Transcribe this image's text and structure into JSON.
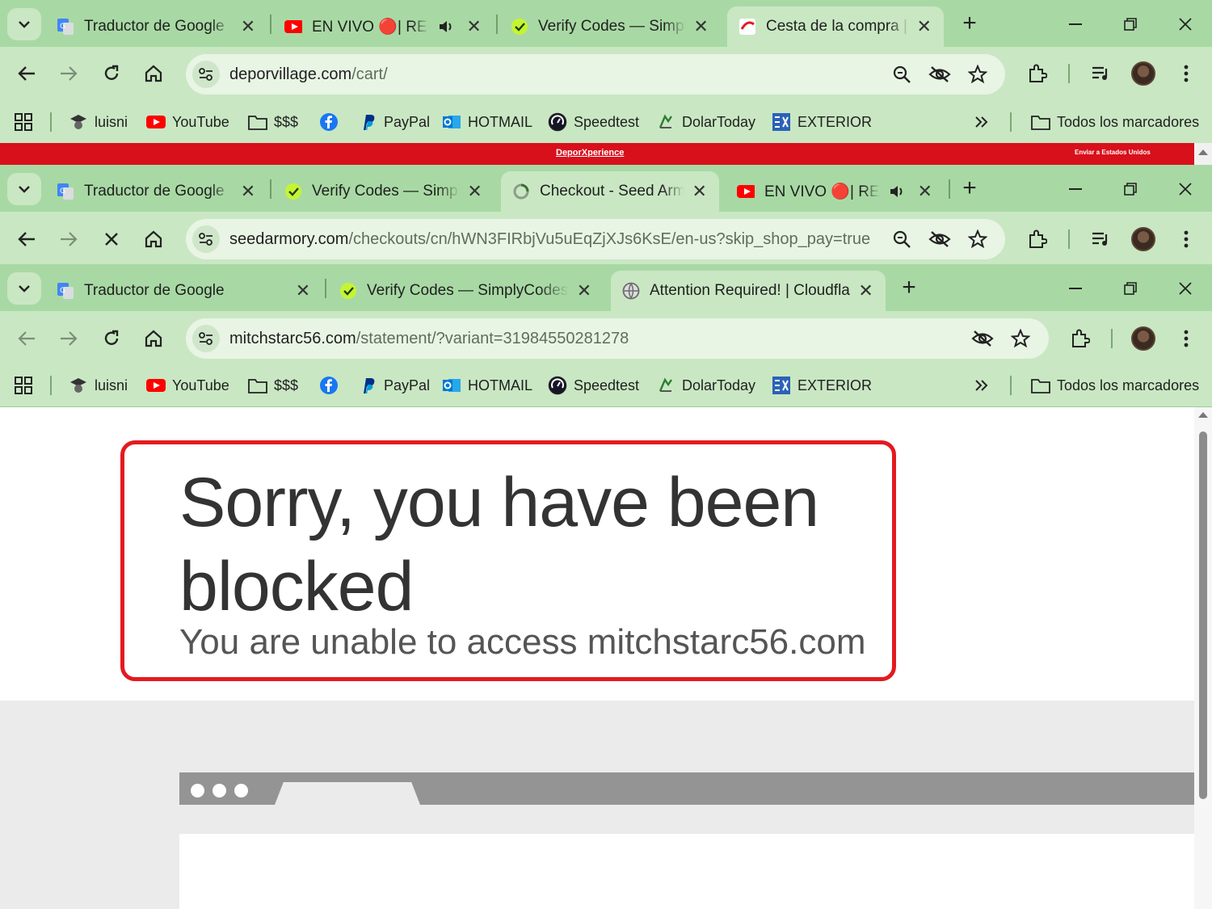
{
  "window1": {
    "tabs": [
      {
        "title": "Traductor de Google",
        "favicon": "google-translate-icon"
      },
      {
        "title": "EN VIVO 🔴| REUN",
        "favicon": "youtube-icon",
        "audio": true
      },
      {
        "title": "Verify Codes — Simply",
        "favicon": "simplycodes-icon"
      },
      {
        "title": "Cesta de la compra | d",
        "favicon": "deporvillage-icon",
        "active": true
      }
    ],
    "url_host": "deporvillage.com",
    "url_path": "/cart/"
  },
  "window2": {
    "tabs": [
      {
        "title": "Traductor de Google",
        "favicon": "google-translate-icon"
      },
      {
        "title": "Verify Codes — Simply",
        "favicon": "simplycodes-icon"
      },
      {
        "title": "Checkout - Seed Armo",
        "favicon": "loading-icon",
        "active": true
      },
      {
        "title": "EN VIVO 🔴| REUN",
        "favicon": "youtube-icon",
        "audio": true
      }
    ],
    "url_host": "seedarmory.com",
    "url_path": "/checkouts/cn/hWN3FIRbjVu5uEqZjXJs6KsE/en-us?skip_shop_pay=true"
  },
  "window3": {
    "tabs": [
      {
        "title": "Traductor de Google",
        "favicon": "google-translate-icon"
      },
      {
        "title": "Verify Codes — SimplyCodes",
        "favicon": "simplycodes-icon"
      },
      {
        "title": "Attention Required! | Cloudflare",
        "favicon": "globe-icon",
        "active": true
      }
    ],
    "url_host": "mitchstarc56.com",
    "url_path": "/statement/?variant=31984550281278"
  },
  "bookmarks": [
    {
      "label": "luisni",
      "icon": "graduate-icon"
    },
    {
      "label": "YouTube",
      "icon": "youtube-icon"
    },
    {
      "label": "$$$",
      "icon": "folder-icon"
    },
    {
      "label": "",
      "icon": "facebook-icon"
    },
    {
      "label": "PayPal",
      "icon": "paypal-icon"
    },
    {
      "label": "HOTMAIL",
      "icon": "outlook-icon"
    },
    {
      "label": "Speedtest",
      "icon": "speedtest-icon"
    },
    {
      "label": "DolarToday",
      "icon": "dolartoday-icon"
    },
    {
      "label": "EXTERIOR",
      "icon": "exterior-icon"
    }
  ],
  "all_bookmarks_label": "Todos los marcadores",
  "deporvillage": {
    "brand": "DeporXperience",
    "ship_to": "Enviar a Estados Unidos"
  },
  "page": {
    "headline": "Sorry, you have been blocked",
    "subheadline": "You are unable to access mitchstarc56.com"
  },
  "colors": {
    "chrome_frame": "#a8d9a4",
    "chrome_toolbar": "#c9e7c3",
    "highlight_box": "#e31a1f",
    "deporvillage_red": "#d8101c"
  }
}
